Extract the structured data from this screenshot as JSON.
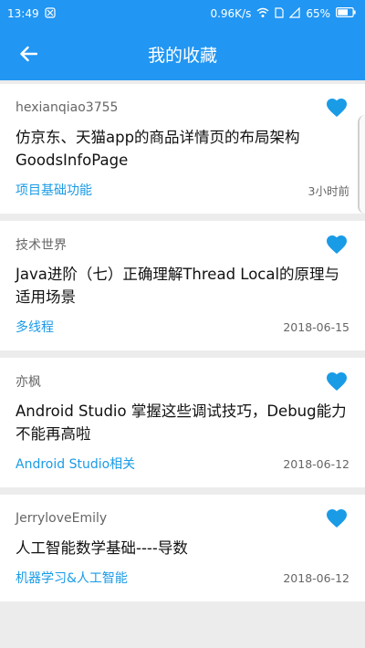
{
  "status_bar": {
    "time": "13:49",
    "speed": "0.96K/s",
    "battery": "65%"
  },
  "header": {
    "title": "我的收藏"
  },
  "colors": {
    "primary": "#2196f3",
    "accent": "#1a9be6",
    "background": "#ececec"
  },
  "favorites": [
    {
      "author": "hexianqiao3755",
      "title": "仿京东、天猫app的商品详情页的布局架构GoodsInfoPage",
      "tag": "项目基础功能",
      "time": "3小时前"
    },
    {
      "author": "技术世界",
      "title": "Java进阶（七）正确理解Thread Local的原理与适用场景",
      "tag": "多线程",
      "time": "2018-06-15"
    },
    {
      "author": "亦枫",
      "title": "Android Studio 掌握这些调试技巧，Debug能力不能再高啦",
      "tag": "Android Studio相关",
      "time": "2018-06-12"
    },
    {
      "author": "JerryloveEmily",
      "title": "人工智能数学基础----导数",
      "tag": "机器学习&人工智能",
      "time": "2018-06-12"
    }
  ]
}
